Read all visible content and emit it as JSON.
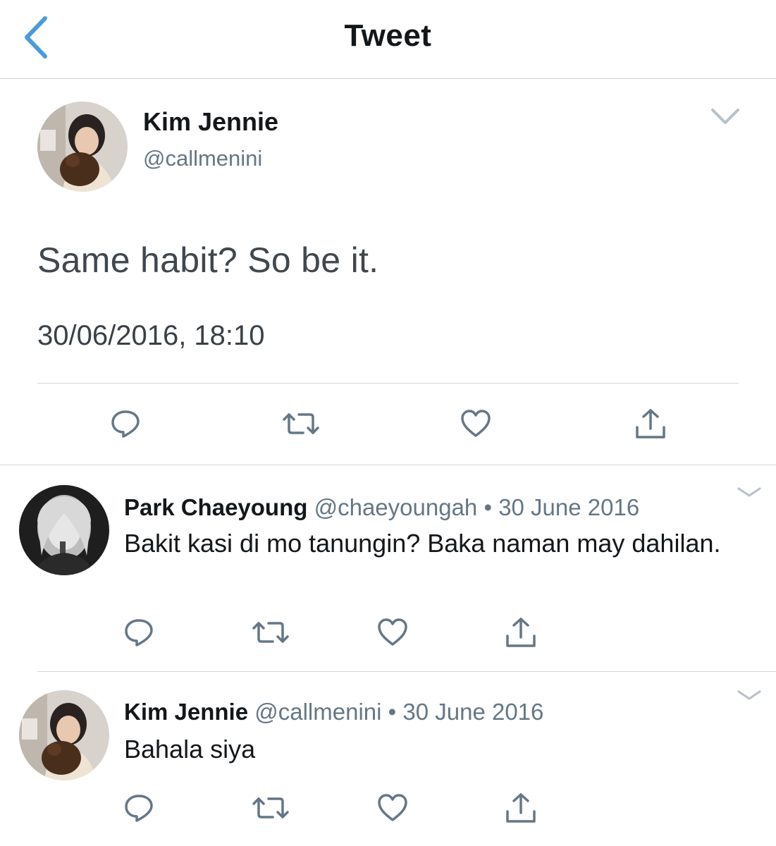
{
  "header": {
    "title": "Tweet",
    "accent_color": "#4a9bdc"
  },
  "main_tweet": {
    "author_name": "Kim Jennie",
    "handle": "@callmenini",
    "text": "Same habit? So be it.",
    "timestamp": "30/06/2016, 18:10",
    "actions": [
      "reply-icon",
      "retweet-icon",
      "like-icon",
      "share-icon"
    ]
  },
  "replies": [
    {
      "author_name": "Park Chaeyoung",
      "handle": "@chaeyoungah",
      "separator": "•",
      "date": "30 June 2016",
      "text": "Bakit kasi di mo tanungin? Baka naman may dahilan."
    },
    {
      "author_name": "Kim Jennie",
      "handle": "@callmenini",
      "separator": "•",
      "date": "30 June 2016",
      "text": "Bahala siya"
    }
  ],
  "colors": {
    "text_primary": "#14171a",
    "text_secondary": "#657786",
    "divider": "#cfd4d8",
    "icon": "#657786"
  }
}
